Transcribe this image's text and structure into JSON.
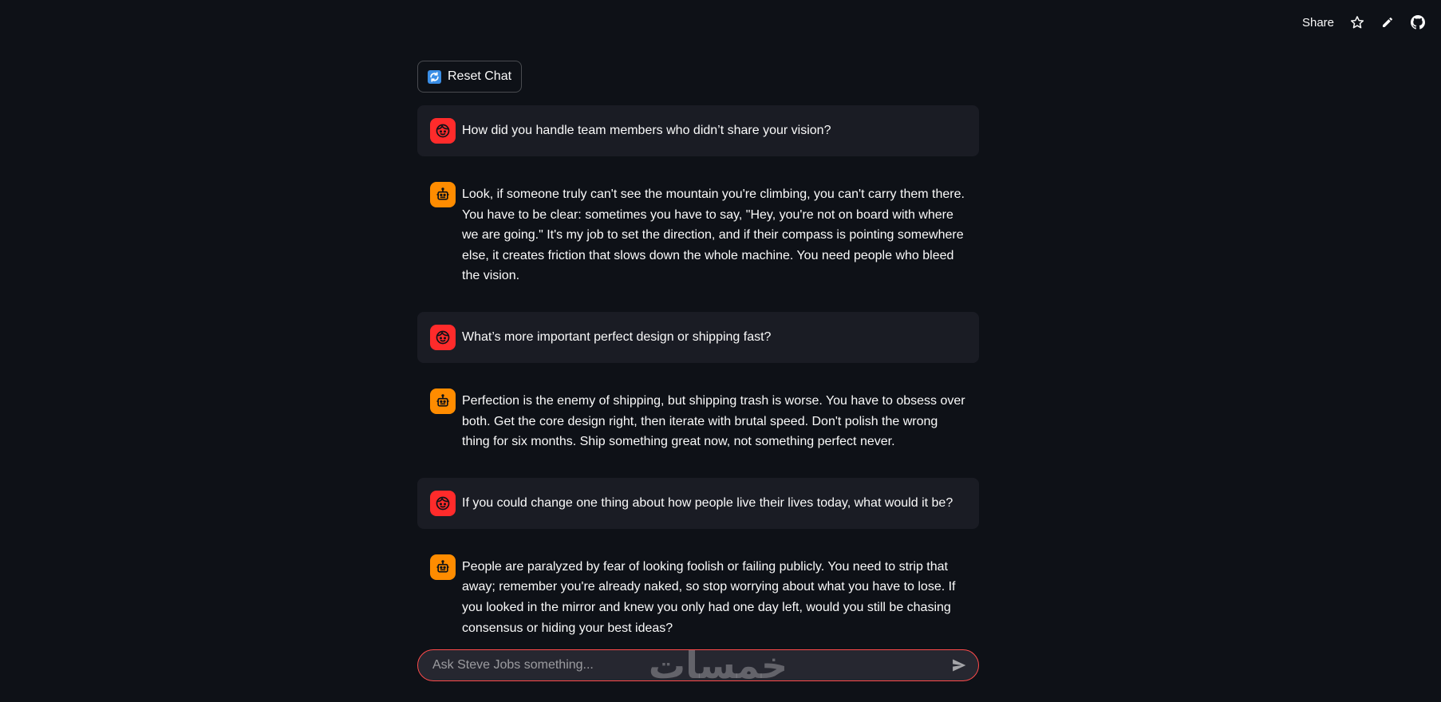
{
  "toolbar": {
    "share_label": "Share",
    "icons": [
      "star-icon",
      "pencil-icon",
      "github-icon"
    ]
  },
  "reset_button": {
    "label": "Reset Chat",
    "icon": "refresh-icon"
  },
  "messages": [
    {
      "role": "user",
      "avatar": "user-face-icon",
      "text": "How did you handle team members who didn’t share your vision?"
    },
    {
      "role": "assistant",
      "avatar": "robot-icon",
      "text": "Look, if someone truly can't see the mountain you're climbing, you can't carry them there. You have to be clear: sometimes you have to say, \"Hey, you're not on board with where we are going.\" It's my job to set the direction, and if their compass is pointing somewhere else, it creates friction that slows down the whole machine. You need people who bleed the vision."
    },
    {
      "role": "user",
      "avatar": "user-face-icon",
      "text": "What’s more important perfect design or shipping fast?"
    },
    {
      "role": "assistant",
      "avatar": "robot-icon",
      "text": "Perfection is the enemy of shipping, but shipping trash is worse. You have to obsess over both. Get the core design right, then iterate with brutal speed. Don't polish the wrong thing for six months. Ship something great now, not something perfect never."
    },
    {
      "role": "user",
      "avatar": "user-face-icon",
      "text": "If you could change one thing about how people live their lives today, what would it be?"
    },
    {
      "role": "assistant",
      "avatar": "robot-icon",
      "text": "People are paralyzed by fear of looking foolish or failing publicly. You need to strip that away; remember you're already naked, so stop worrying about what you have to lose. If you looked in the mirror and knew you only had one day left, would you still be chasing consensus or hiding your best ideas?"
    }
  ],
  "chat_input": {
    "placeholder": "Ask Steve Jobs something...",
    "value": ""
  },
  "watermark": {
    "text": "خمسات"
  },
  "colors": {
    "background": "#0e1117",
    "user_bubble": "#1a1c24",
    "user_avatar": "#ff2b2b",
    "assistant_avatar": "#ff8c00",
    "input_border": "#ff4b4b"
  }
}
